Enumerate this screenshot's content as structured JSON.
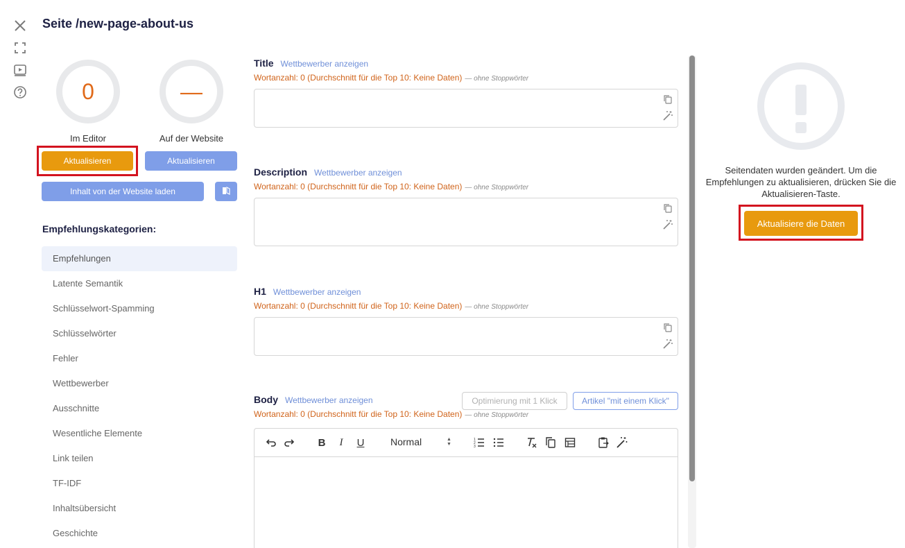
{
  "page": {
    "title": "Seite /new-page-about-us"
  },
  "rail": {
    "icons": [
      "close-icon",
      "fullscreen-icon",
      "video-icon",
      "help-icon"
    ]
  },
  "scores": {
    "editor": {
      "value": "0",
      "label": "Im Editor",
      "button": "Aktualisieren"
    },
    "website": {
      "value": "—",
      "label": "Auf der Website",
      "button": "Aktualisieren"
    }
  },
  "load_button": "Inhalt von der Website laden",
  "categories": {
    "heading": "Empfehlungskategorien:",
    "items": [
      "Empfehlungen",
      "Latente Semantik",
      "Schlüsselwort-Spamming",
      "Schlüsselwörter",
      "Fehler",
      "Wettbewerber",
      "Ausschnitte",
      "Wesentliche Elemente",
      "Link teilen",
      "TF-IDF",
      "Inhaltsübersicht",
      "Geschichte"
    ],
    "active": "Empfehlungen"
  },
  "fields": {
    "title": {
      "label": "Title",
      "link": "Wettbewerber anzeigen",
      "count": "Wortanzahl: 0 (Durchschnitt für die Top 10: Keine Daten)",
      "note": "— ohne Stoppwörter"
    },
    "description": {
      "label": "Description",
      "link": "Wettbewerber anzeigen",
      "count": "Wortanzahl: 0 (Durchschnitt für die Top 10: Keine Daten)",
      "note": "— ohne Stoppwörter"
    },
    "h1": {
      "label": "H1",
      "link": "Wettbewerber anzeigen",
      "count": "Wortanzahl: 0 (Durchschnitt für die Top 10: Keine Daten)",
      "note": "— ohne Stoppwörter"
    },
    "body": {
      "label": "Body",
      "link": "Wettbewerber anzeigen",
      "count": "Wortanzahl: 0 (Durchschnitt für die Top 10: Keine Daten)",
      "note": "— ohne Stoppwörter",
      "optimize_btn": "Optimierung mit 1 Klick",
      "article_btn": "Artikel \"mit einem Klick\""
    }
  },
  "editor_toolbar": {
    "format_select": "Normal"
  },
  "right_panel": {
    "message": "Seitendaten wurden geändert. Um die Empfehlungen zu aktualisieren, drücken Sie die Aktualisieren-Taste.",
    "button": "Aktualisiere die Daten"
  },
  "colors": {
    "accent_orange": "#e89a0e",
    "accent_blue": "#7f9ee8",
    "highlight_red": "#d3131f",
    "wordcount_orange": "#d0631a"
  }
}
